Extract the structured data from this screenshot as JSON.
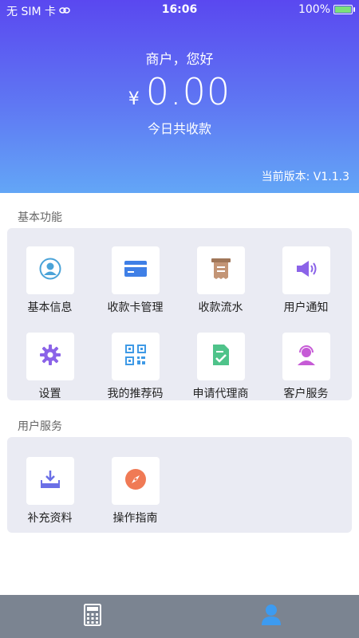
{
  "status_bar": {
    "carrier": "无 SIM 卡",
    "time": "16:06",
    "battery": "100%"
  },
  "header": {
    "greeting": "商户，您好",
    "currency": "¥",
    "amount": "0.00",
    "amount_label": "今日共收款",
    "version": "当前版本: V1.1.3"
  },
  "basic": {
    "title": "基本功能",
    "items": [
      {
        "label": "基本信息",
        "icon": "user-avatar-icon"
      },
      {
        "label": "收款卡管理",
        "icon": "card-icon"
      },
      {
        "label": "收款流水",
        "icon": "receipt-icon"
      },
      {
        "label": "用户通知",
        "icon": "speaker-icon"
      },
      {
        "label": "设置",
        "icon": "gear-icon"
      },
      {
        "label": "我的推荐码",
        "icon": "qr-code-icon"
      },
      {
        "label": "申请代理商",
        "icon": "document-check-icon"
      },
      {
        "label": "客户服务",
        "icon": "headset-icon"
      }
    ]
  },
  "user_services": {
    "title": "用户服务",
    "items": [
      {
        "label": "补充资料",
        "icon": "download-tray-icon"
      },
      {
        "label": "操作指南",
        "icon": "compass-icon"
      }
    ]
  },
  "tabbar": {
    "tabs": [
      {
        "icon": "calculator-icon"
      },
      {
        "icon": "person-icon"
      }
    ]
  },
  "colors": {
    "header_top": "#5a48f0",
    "header_bottom": "#63a6f6",
    "panel": "#eaebf3",
    "tabbar": "#7b8491",
    "active_tab": "#3d9bf0"
  }
}
